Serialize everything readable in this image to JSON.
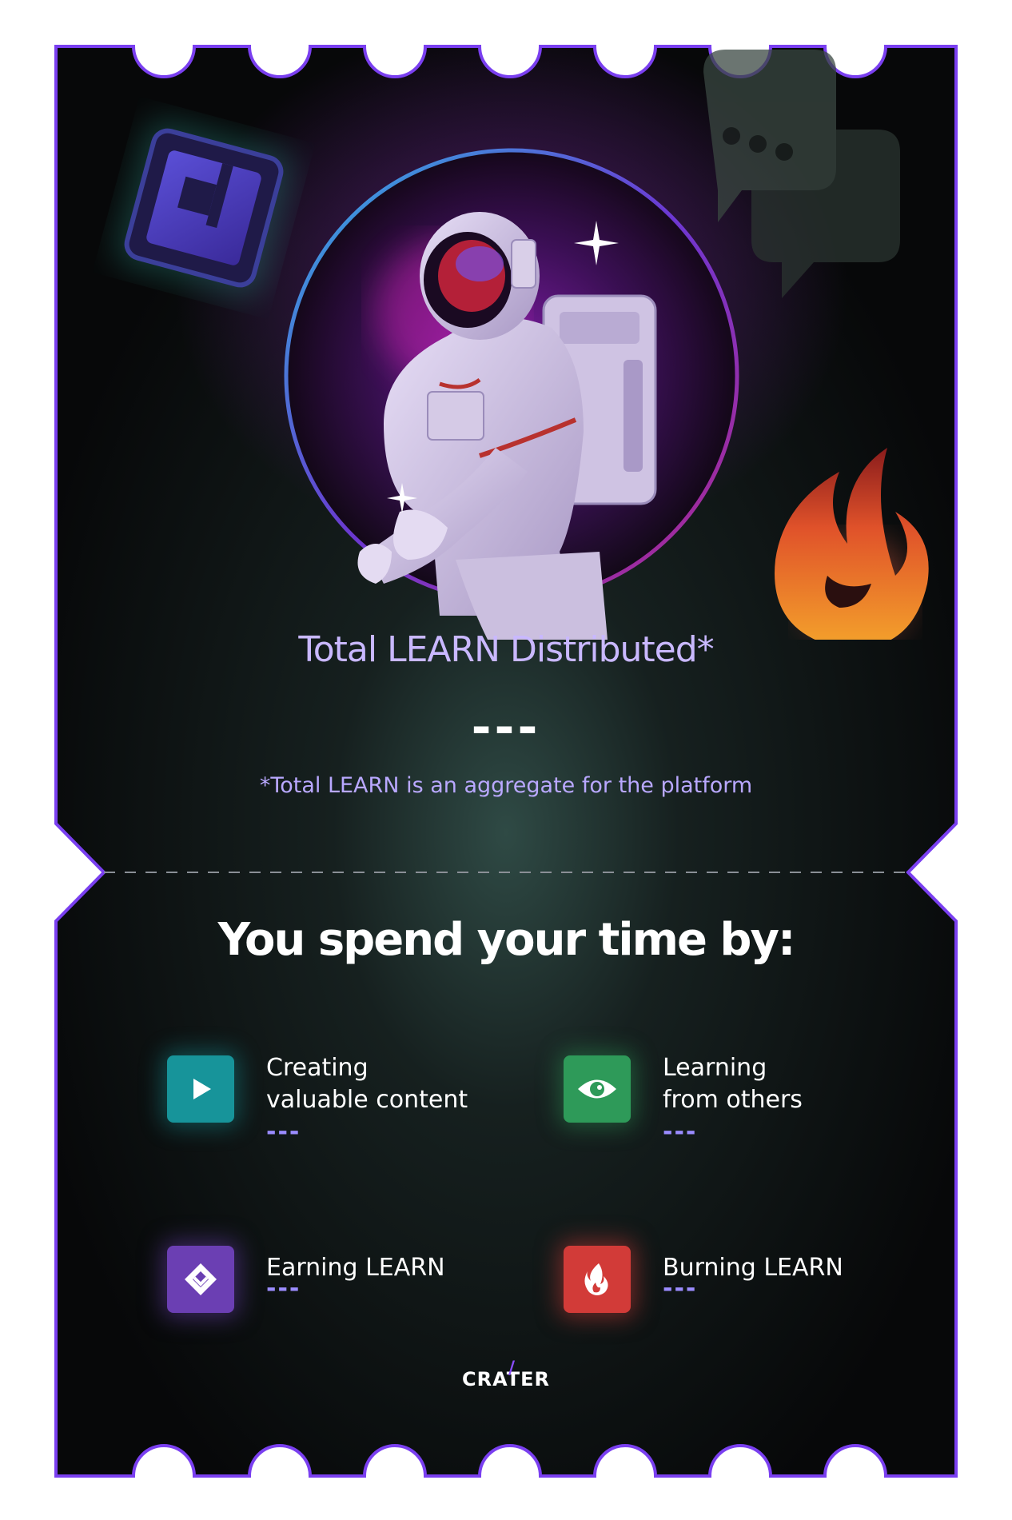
{
  "hero": {
    "title": "Total LEARN Distributed*",
    "value": "---",
    "footnote": "*Total LEARN is an aggregate for the platform"
  },
  "section": {
    "title": "You spend your time by:"
  },
  "activities": [
    {
      "label": "Creating\nvaluable content",
      "value": "---",
      "icon": "play-icon",
      "color": "#17949a"
    },
    {
      "label": "Learning\nfrom others",
      "value": "---",
      "icon": "eye-icon",
      "color": "#2e9a59"
    },
    {
      "label": "Earning LEARN",
      "value": "---",
      "icon": "learn-token-icon",
      "color": "#6b3fb3"
    },
    {
      "label": "Burning LEARN",
      "value": "---",
      "icon": "flame-icon",
      "color": "#d23b38"
    }
  ],
  "brand": {
    "name": "CRATER"
  },
  "colors": {
    "ticket_border": "#7a3ff0",
    "background": "#0b0d10",
    "accent_text": "#c9b8ff",
    "value_dash": "#9b8cff"
  }
}
